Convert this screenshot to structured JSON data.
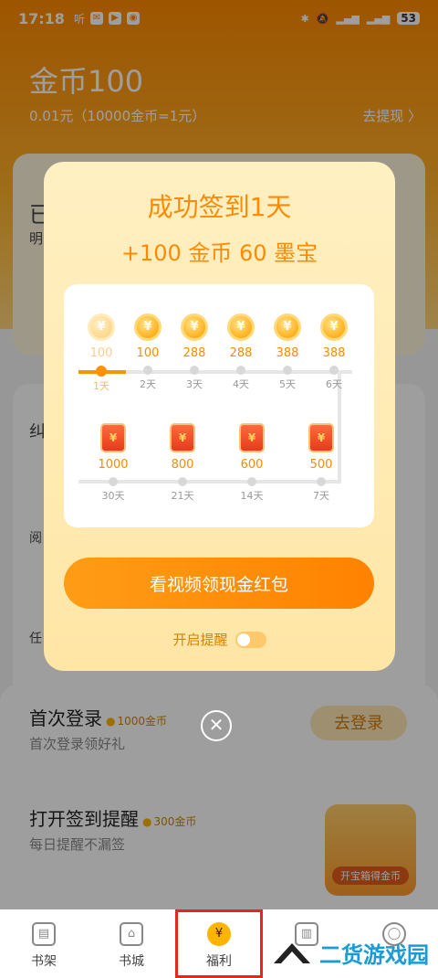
{
  "status_bar": {
    "time": "17:18",
    "app_label": "听",
    "battery": "53"
  },
  "header": {
    "coin_title": "金币100",
    "exchange_text": "0.01元（10000金币=1元）",
    "withdraw_label": "去提现 〉"
  },
  "peek_text": {
    "p1": "已",
    "p2": "明",
    "p3": "纠",
    "p4": "阅",
    "p5": "任"
  },
  "dialog": {
    "title": "成功签到1天",
    "reward": "+100 金币 60 墨宝",
    "week": [
      {
        "value": "100",
        "label": "1天",
        "active": true
      },
      {
        "value": "100",
        "label": "2天"
      },
      {
        "value": "288",
        "label": "3天"
      },
      {
        "value": "288",
        "label": "4天"
      },
      {
        "value": "388",
        "label": "5天"
      },
      {
        "value": "388",
        "label": "6天"
      }
    ],
    "milestones": [
      {
        "value": "1000",
        "label": "30天"
      },
      {
        "value": "800",
        "label": "21天"
      },
      {
        "value": "600",
        "label": "14天"
      },
      {
        "value": "500",
        "label": "7天"
      }
    ],
    "cta_label": "看视频领现金红包",
    "reminder_label": "开启提醒",
    "reminder_on": false
  },
  "tasks": [
    {
      "title": "首次登录",
      "coins": "1000金币",
      "desc": "首次登录领好礼",
      "button": "去登录"
    },
    {
      "title": "打开签到提醒",
      "coins": "300金币",
      "desc": "每日提醒不漏签"
    }
  ],
  "treasure_label": "开宝箱得金币",
  "nav": [
    {
      "label": "书架",
      "icon": "bookshelf-icon"
    },
    {
      "label": "书城",
      "icon": "home-icon"
    },
    {
      "label": "福利",
      "icon": "money-bag-icon",
      "active": true
    },
    {
      "label": "",
      "icon": "category-icon"
    },
    {
      "label": "",
      "icon": "profile-icon"
    }
  ],
  "watermark": "二货游戏园",
  "colors": {
    "accent": "#ff8a00",
    "highlight_box": "#e8261c"
  }
}
